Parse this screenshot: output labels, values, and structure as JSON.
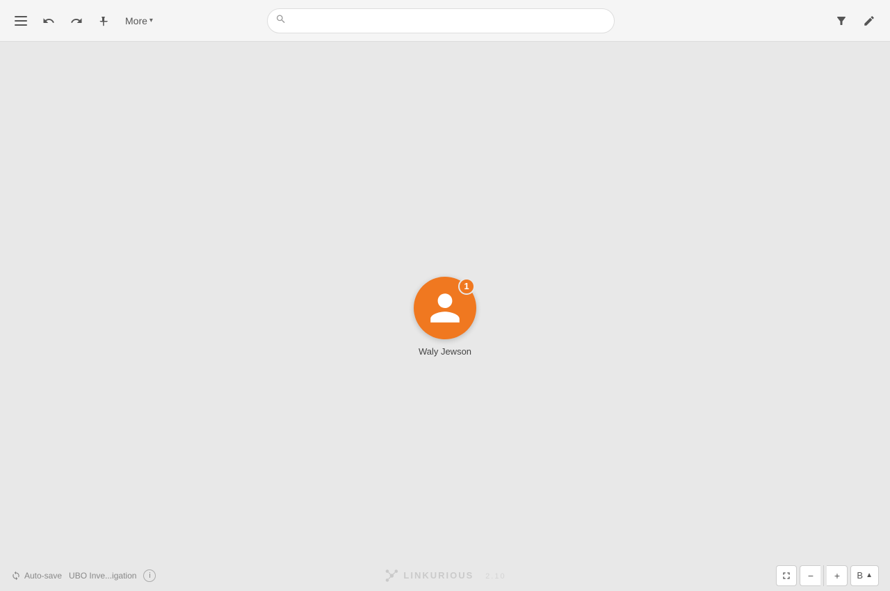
{
  "toolbar": {
    "more_label": "More",
    "search_placeholder": "",
    "undo_label": "Undo",
    "redo_label": "Redo",
    "pin_label": "Pin",
    "filter_label": "Filter",
    "edit_label": "Edit"
  },
  "node": {
    "label": "Waly Jewson",
    "badge_count": "1",
    "color": "#F07820"
  },
  "bottom": {
    "autosave_label": "Auto-save",
    "investigation_name": "UBO Inve...igation",
    "logo_text": "LINKURIOUS",
    "logo_version": "2.10",
    "zoom_minus": "−",
    "zoom_plus": "+",
    "layout_label": "B",
    "fullscreen_label": "⛶"
  }
}
